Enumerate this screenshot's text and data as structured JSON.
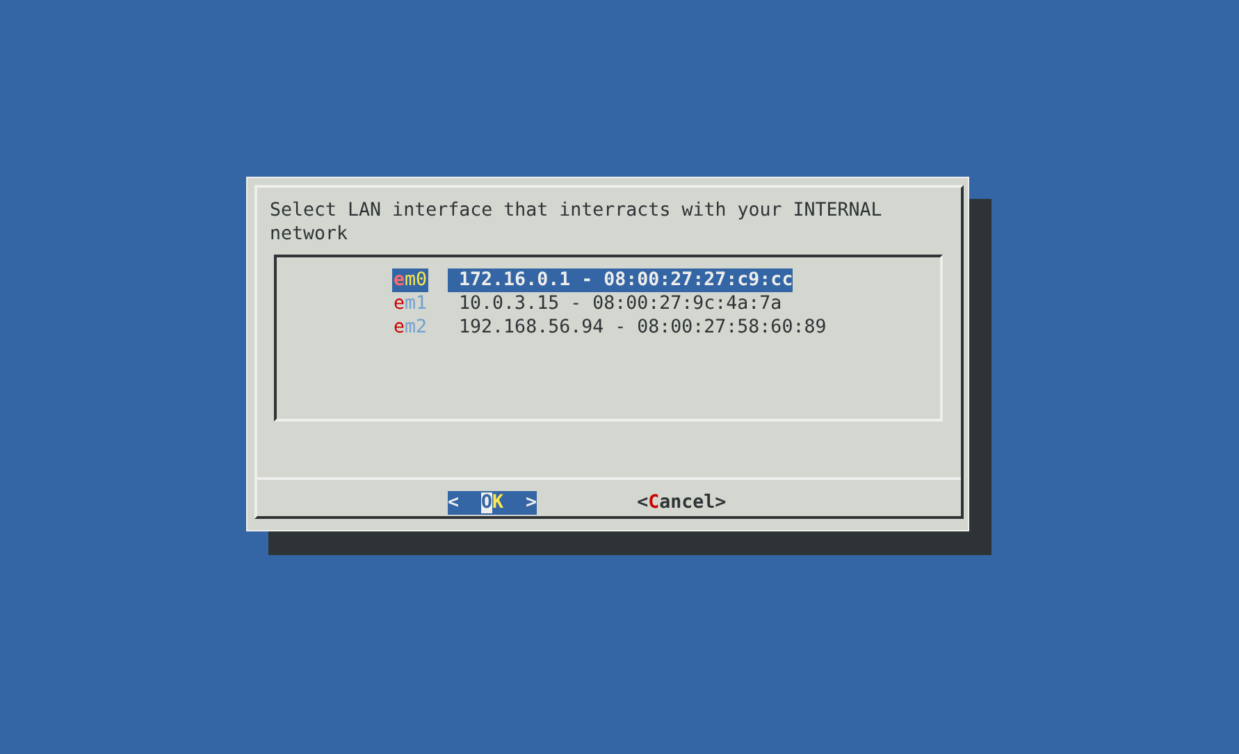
{
  "dialog": {
    "prompt": "Select LAN interface that interracts with your INTERNAL network",
    "items": [
      {
        "tag": "em0",
        "description": "172.16.0.1 - 08:00:27:27:c9:cc",
        "selected": true
      },
      {
        "tag": "em1",
        "description": "10.0.3.15 - 08:00:27:9c:4a:7a",
        "selected": false
      },
      {
        "tag": "em2",
        "description": "192.168.56.94 - 08:00:27:58:60:89",
        "selected": false
      }
    ],
    "buttons": [
      {
        "open": "<",
        "label": "OK",
        "close": ">",
        "selected": true
      },
      {
        "open": "<",
        "label": "Cancel",
        "close": ">",
        "selected": false
      }
    ]
  }
}
